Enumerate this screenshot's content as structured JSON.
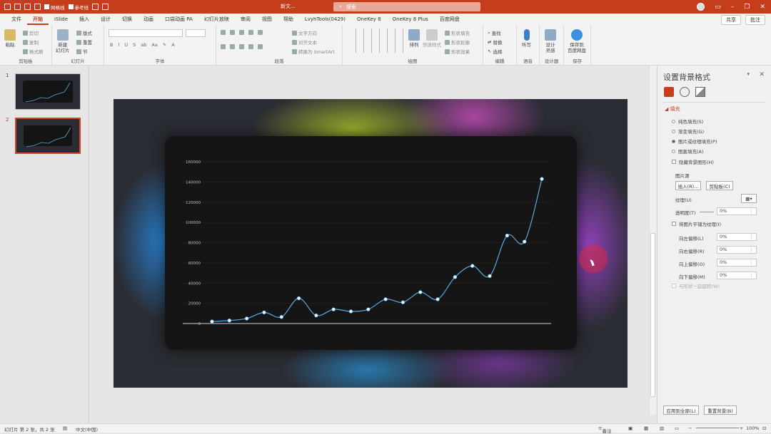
{
  "titlebar": {
    "doc_title": "新文...",
    "search_placeholder": "搜索",
    "qa_gridlines": "网格线",
    "qa_guides": "参考线"
  },
  "tabs": [
    "文件",
    "开始",
    "iSlide",
    "插入",
    "设计",
    "切换",
    "动画",
    "口袋动画 PA",
    "幻灯片放映",
    "审阅",
    "视图",
    "帮助",
    "LvyhTools(0429)",
    "OneKey 8",
    "OneKey 8 Plus",
    "百度网盘"
  ],
  "tabs_right": {
    "share": "共享",
    "comment": "批注"
  },
  "ribbon": {
    "clipboard": {
      "paste": "粘贴",
      "cut": "剪切",
      "copy": "复制",
      "format_painter": "格式刷",
      "label": "剪贴板"
    },
    "slides": {
      "new_slide": "新建\n幻灯片",
      "layout": "版式",
      "reset": "重置",
      "section": "节",
      "label": "幻灯片"
    },
    "font": {
      "label": "字体"
    },
    "paragraph": {
      "text_direction": "文字方向",
      "align_text": "对齐文本",
      "smartart": "转换为 SmartArt",
      "label": "段落"
    },
    "drawing": {
      "arrange": "排列",
      "quick_styles": "快速样式",
      "fill": "形状填充",
      "outline": "形状轮廓",
      "effects": "形状效果",
      "label": "绘图"
    },
    "editing": {
      "find": "查找",
      "replace": "替换",
      "select": "选择",
      "label": "编辑"
    },
    "voice": {
      "dictate": "听写",
      "label": "语音"
    },
    "designer": {
      "design_ideas": "设计\n灵感",
      "label": "设计器"
    },
    "save": {
      "save_baidu": "保存到\n百度网盘",
      "label": "保存"
    }
  },
  "slides_pane": [
    {
      "num": "1"
    },
    {
      "num": "2",
      "selected": true
    }
  ],
  "chart_data": {
    "type": "line",
    "y_ticks": [
      "0",
      "20000",
      "40000",
      "60000",
      "80000",
      "100000",
      "120000",
      "140000",
      "160000"
    ],
    "ylim": [
      0,
      160000
    ],
    "values": [
      2000,
      3000,
      5000,
      11000,
      6500,
      25000,
      8000,
      14000,
      12000,
      14000,
      24000,
      21000,
      31000,
      24000,
      46000,
      57000,
      47000,
      87000,
      81000,
      143000
    ],
    "line_color": "#5aa9e0",
    "marker_color": "#e8f4ff"
  },
  "panel": {
    "title": "设置背景格式",
    "section_fill": "填充",
    "options": [
      {
        "label": "纯色填充(S)",
        "checked": false
      },
      {
        "label": "渐变填充(G)",
        "checked": false
      },
      {
        "label": "图片或纹理填充(P)",
        "checked": true
      },
      {
        "label": "图案填充(A)",
        "checked": false
      }
    ],
    "hide_bg": "隐藏背景图形(H)",
    "picture_source": "图片源",
    "insert_btn": "插入(R)...",
    "clipboard_btn": "剪贴板(C)",
    "texture": "纹理(U)",
    "transparency": "透明度(T)",
    "transparency_value": "0%",
    "tile": "将图片平铺为纹理(I)",
    "offsets": [
      {
        "label": "向左偏移(L)",
        "value": "0%"
      },
      {
        "label": "向右偏移(R)",
        "value": "0%"
      },
      {
        "label": "向上偏移(O)",
        "value": "0%"
      },
      {
        "label": "向下偏移(M)",
        "value": "0%"
      }
    ],
    "rotate_with_shape": "与形状一起旋转(W)",
    "apply_all": "应用到全部(L)",
    "reset_bg": "重置背景(B)"
  },
  "status": {
    "slide_info": "幻灯片 第 2 张，共 2 张",
    "language": "中文(中国)",
    "notes": "备注",
    "zoom": "100%"
  }
}
